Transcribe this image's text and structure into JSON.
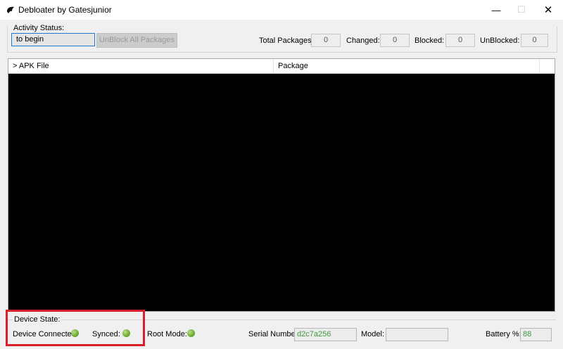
{
  "window": {
    "title": "Debloater by Gatesjunior",
    "minimize_glyph": "—",
    "maximize_glyph": "☐",
    "close_glyph": "✕",
    "app_icon": "debloater-app-icon"
  },
  "activity": {
    "group_label": "Activity Status:",
    "status_value": "to begin",
    "unblock_button_label": "UnBlock All Packages",
    "stats": [
      {
        "label": "Total Packages:",
        "value": "0"
      },
      {
        "label": "Changed:",
        "value": "0"
      },
      {
        "label": "Blocked:",
        "value": "0"
      },
      {
        "label": "UnBlocked:",
        "value": "0"
      }
    ]
  },
  "table": {
    "columns": [
      "> APK File",
      "Package"
    ],
    "background": "#000000"
  },
  "device": {
    "group_label": "Device State:",
    "indicators": [
      {
        "label": "Device Connected:",
        "status": "on"
      },
      {
        "label": "Synced:",
        "status": "on"
      },
      {
        "label": "Root Mode:",
        "status": "on"
      }
    ],
    "serial_label": "Serial Number:",
    "serial_value": "d2c7a256",
    "model_label": "Model:",
    "model_value": "",
    "battery_label": "Battery %:",
    "battery_value": "88"
  },
  "colors": {
    "highlight": "#d9202a",
    "led_green": "#6eab2f",
    "value_green": "#3c9a3c",
    "focus_blue": "#1e7bd0"
  }
}
